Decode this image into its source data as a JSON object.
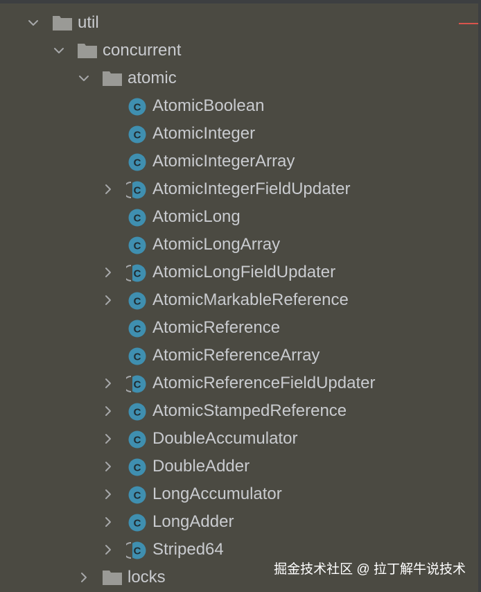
{
  "colors": {
    "background": "#4b4a42",
    "text": "#c9cbcf",
    "folder": "#9a9a96",
    "class_icon": "#3f8fb0",
    "chevron": "#a7a8aa"
  },
  "tree": {
    "util": {
      "label": "util",
      "expanded": true,
      "icon": "folder-icon"
    },
    "concurrent": {
      "label": "concurrent",
      "expanded": true,
      "icon": "folder-icon"
    },
    "atomic": {
      "label": "atomic",
      "expanded": true,
      "icon": "folder-icon"
    },
    "classes": [
      {
        "label": "AtomicBoolean",
        "icon": "class-icon",
        "kind": "class",
        "expandable": false
      },
      {
        "label": "AtomicInteger",
        "icon": "class-icon",
        "kind": "class",
        "expandable": false
      },
      {
        "label": "AtomicIntegerArray",
        "icon": "class-icon",
        "kind": "class",
        "expandable": false
      },
      {
        "label": "AtomicIntegerFieldUpdater",
        "icon": "abstract-class-icon",
        "kind": "abstract",
        "expandable": true
      },
      {
        "label": "AtomicLong",
        "icon": "class-icon",
        "kind": "class",
        "expandable": false
      },
      {
        "label": "AtomicLongArray",
        "icon": "class-icon",
        "kind": "class",
        "expandable": false
      },
      {
        "label": "AtomicLongFieldUpdater",
        "icon": "abstract-class-icon",
        "kind": "abstract",
        "expandable": true
      },
      {
        "label": "AtomicMarkableReference",
        "icon": "class-icon",
        "kind": "class",
        "expandable": true
      },
      {
        "label": "AtomicReference",
        "icon": "class-icon",
        "kind": "class",
        "expandable": false
      },
      {
        "label": "AtomicReferenceArray",
        "icon": "class-icon",
        "kind": "class",
        "expandable": false
      },
      {
        "label": "AtomicReferenceFieldUpdater",
        "icon": "abstract-class-icon",
        "kind": "abstract",
        "expandable": true
      },
      {
        "label": "AtomicStampedReference",
        "icon": "class-icon",
        "kind": "class",
        "expandable": true
      },
      {
        "label": "DoubleAccumulator",
        "icon": "class-icon",
        "kind": "class",
        "expandable": true
      },
      {
        "label": "DoubleAdder",
        "icon": "class-icon",
        "kind": "class",
        "expandable": true
      },
      {
        "label": "LongAccumulator",
        "icon": "class-icon",
        "kind": "class",
        "expandable": true
      },
      {
        "label": "LongAdder",
        "icon": "class-icon",
        "kind": "class",
        "expandable": true
      },
      {
        "label": "Striped64",
        "icon": "abstract-class-icon",
        "kind": "abstract",
        "expandable": true
      }
    ],
    "locks": {
      "label": "locks",
      "expanded": false,
      "icon": "folder-icon"
    }
  },
  "watermark": "掘金技术社区 @ 拉丁解牛说技术"
}
